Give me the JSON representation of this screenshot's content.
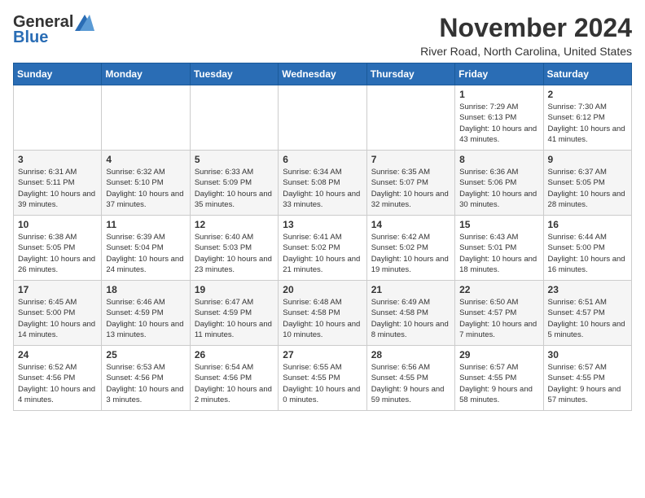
{
  "logo": {
    "general": "General",
    "blue": "Blue"
  },
  "header": {
    "month_title": "November 2024",
    "location": "River Road, North Carolina, United States"
  },
  "weekdays": [
    "Sunday",
    "Monday",
    "Tuesday",
    "Wednesday",
    "Thursday",
    "Friday",
    "Saturday"
  ],
  "weeks": [
    [
      {
        "day": "",
        "info": ""
      },
      {
        "day": "",
        "info": ""
      },
      {
        "day": "",
        "info": ""
      },
      {
        "day": "",
        "info": ""
      },
      {
        "day": "",
        "info": ""
      },
      {
        "day": "1",
        "info": "Sunrise: 7:29 AM\nSunset: 6:13 PM\nDaylight: 10 hours and 43 minutes."
      },
      {
        "day": "2",
        "info": "Sunrise: 7:30 AM\nSunset: 6:12 PM\nDaylight: 10 hours and 41 minutes."
      }
    ],
    [
      {
        "day": "3",
        "info": "Sunrise: 6:31 AM\nSunset: 5:11 PM\nDaylight: 10 hours and 39 minutes."
      },
      {
        "day": "4",
        "info": "Sunrise: 6:32 AM\nSunset: 5:10 PM\nDaylight: 10 hours and 37 minutes."
      },
      {
        "day": "5",
        "info": "Sunrise: 6:33 AM\nSunset: 5:09 PM\nDaylight: 10 hours and 35 minutes."
      },
      {
        "day": "6",
        "info": "Sunrise: 6:34 AM\nSunset: 5:08 PM\nDaylight: 10 hours and 33 minutes."
      },
      {
        "day": "7",
        "info": "Sunrise: 6:35 AM\nSunset: 5:07 PM\nDaylight: 10 hours and 32 minutes."
      },
      {
        "day": "8",
        "info": "Sunrise: 6:36 AM\nSunset: 5:06 PM\nDaylight: 10 hours and 30 minutes."
      },
      {
        "day": "9",
        "info": "Sunrise: 6:37 AM\nSunset: 5:05 PM\nDaylight: 10 hours and 28 minutes."
      }
    ],
    [
      {
        "day": "10",
        "info": "Sunrise: 6:38 AM\nSunset: 5:05 PM\nDaylight: 10 hours and 26 minutes."
      },
      {
        "day": "11",
        "info": "Sunrise: 6:39 AM\nSunset: 5:04 PM\nDaylight: 10 hours and 24 minutes."
      },
      {
        "day": "12",
        "info": "Sunrise: 6:40 AM\nSunset: 5:03 PM\nDaylight: 10 hours and 23 minutes."
      },
      {
        "day": "13",
        "info": "Sunrise: 6:41 AM\nSunset: 5:02 PM\nDaylight: 10 hours and 21 minutes."
      },
      {
        "day": "14",
        "info": "Sunrise: 6:42 AM\nSunset: 5:02 PM\nDaylight: 10 hours and 19 minutes."
      },
      {
        "day": "15",
        "info": "Sunrise: 6:43 AM\nSunset: 5:01 PM\nDaylight: 10 hours and 18 minutes."
      },
      {
        "day": "16",
        "info": "Sunrise: 6:44 AM\nSunset: 5:00 PM\nDaylight: 10 hours and 16 minutes."
      }
    ],
    [
      {
        "day": "17",
        "info": "Sunrise: 6:45 AM\nSunset: 5:00 PM\nDaylight: 10 hours and 14 minutes."
      },
      {
        "day": "18",
        "info": "Sunrise: 6:46 AM\nSunset: 4:59 PM\nDaylight: 10 hours and 13 minutes."
      },
      {
        "day": "19",
        "info": "Sunrise: 6:47 AM\nSunset: 4:59 PM\nDaylight: 10 hours and 11 minutes."
      },
      {
        "day": "20",
        "info": "Sunrise: 6:48 AM\nSunset: 4:58 PM\nDaylight: 10 hours and 10 minutes."
      },
      {
        "day": "21",
        "info": "Sunrise: 6:49 AM\nSunset: 4:58 PM\nDaylight: 10 hours and 8 minutes."
      },
      {
        "day": "22",
        "info": "Sunrise: 6:50 AM\nSunset: 4:57 PM\nDaylight: 10 hours and 7 minutes."
      },
      {
        "day": "23",
        "info": "Sunrise: 6:51 AM\nSunset: 4:57 PM\nDaylight: 10 hours and 5 minutes."
      }
    ],
    [
      {
        "day": "24",
        "info": "Sunrise: 6:52 AM\nSunset: 4:56 PM\nDaylight: 10 hours and 4 minutes."
      },
      {
        "day": "25",
        "info": "Sunrise: 6:53 AM\nSunset: 4:56 PM\nDaylight: 10 hours and 3 minutes."
      },
      {
        "day": "26",
        "info": "Sunrise: 6:54 AM\nSunset: 4:56 PM\nDaylight: 10 hours and 2 minutes."
      },
      {
        "day": "27",
        "info": "Sunrise: 6:55 AM\nSunset: 4:55 PM\nDaylight: 10 hours and 0 minutes."
      },
      {
        "day": "28",
        "info": "Sunrise: 6:56 AM\nSunset: 4:55 PM\nDaylight: 9 hours and 59 minutes."
      },
      {
        "day": "29",
        "info": "Sunrise: 6:57 AM\nSunset: 4:55 PM\nDaylight: 9 hours and 58 minutes."
      },
      {
        "day": "30",
        "info": "Sunrise: 6:57 AM\nSunset: 4:55 PM\nDaylight: 9 hours and 57 minutes."
      }
    ]
  ]
}
